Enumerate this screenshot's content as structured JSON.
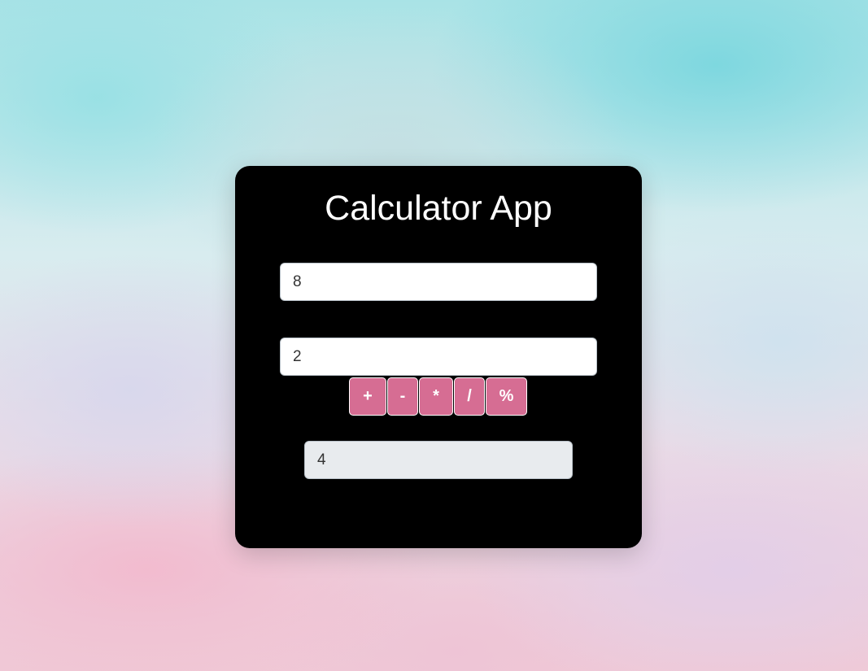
{
  "app": {
    "title": "Calculator App"
  },
  "inputs": {
    "first_value": "8",
    "second_value": "2"
  },
  "operators": [
    {
      "symbol": "+"
    },
    {
      "symbol": "-"
    },
    {
      "symbol": "*"
    },
    {
      "symbol": "/"
    },
    {
      "symbol": "%"
    }
  ],
  "result": {
    "value": "4"
  },
  "colors": {
    "card_background": "#000000",
    "operator_button": "#d66d93",
    "result_background": "#e8ebee"
  }
}
